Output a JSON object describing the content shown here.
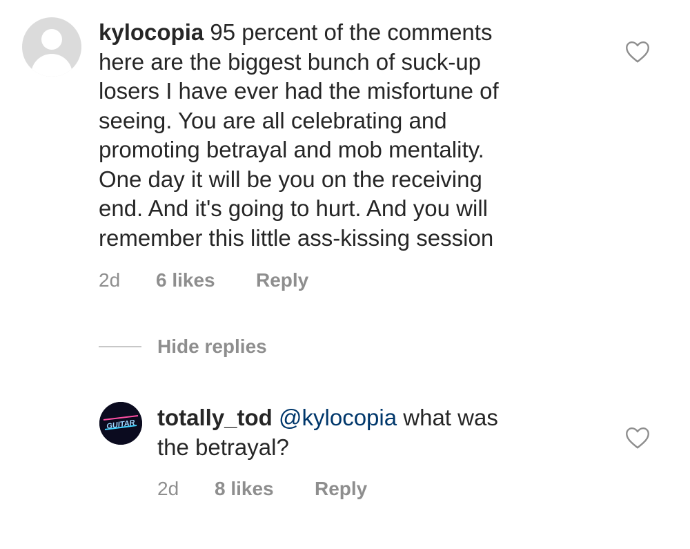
{
  "comments": [
    {
      "username": "kylocopia",
      "text": " 95 percent of the comments\nhere are the biggest bunch of suck-up\nlosers I have ever had the misfortune of\nseeing. You are all celebrating and\npromoting betrayal and mob mentality.\nOne day it will be you on the receiving\nend. And it's going to hurt. And you will\nremember this little ass-kissing session",
      "time": "2d",
      "likes": "6 likes",
      "reply_label": "Reply",
      "avatar_icon": "default-user-avatar-icon"
    }
  ],
  "replies_toggle": {
    "label": "Hide replies"
  },
  "replies": [
    {
      "username": "totally_tod",
      "mention": "@kylocopia",
      "text": " what was\nthe betrayal?",
      "time": "2d",
      "likes": "8 likes",
      "reply_label": "Reply",
      "avatar_icon": "guitar-logo-avatar-icon",
      "avatar_text": "GUITAR"
    }
  ],
  "colors": {
    "text": "#262626",
    "secondary": "#8e8e8e",
    "mention": "#00376b",
    "divider": "#c7c7c7",
    "avatar_placeholder": "#dbdbdb"
  }
}
